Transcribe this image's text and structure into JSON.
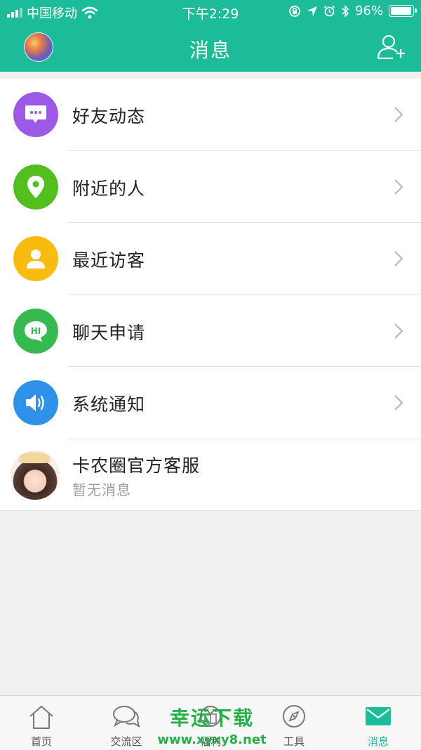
{
  "status_bar": {
    "carrier": "中国移动",
    "time": "下午2:29",
    "battery_text": "96%",
    "battery_level": 0.96,
    "icons": [
      "signal-bars-icon",
      "wifi-icon",
      "orientation-lock-icon",
      "location-arrow-icon",
      "alarm-icon",
      "bluetooth-icon",
      "battery-icon"
    ]
  },
  "header": {
    "title": "消息",
    "left_icon": "user-avatar",
    "right_icon": "add-friend-icon",
    "background_color": "#1dbc98"
  },
  "list": {
    "items": [
      {
        "label": "好友动态",
        "icon": "chat-bubble-icon",
        "color": "#9b59e6"
      },
      {
        "label": "附近的人",
        "icon": "location-pin-icon",
        "color": "#52bf1f"
      },
      {
        "label": "最近访客",
        "icon": "person-icon",
        "color": "#f9bb10"
      },
      {
        "label": "聊天申请",
        "icon": "hi-bubble-icon",
        "color": "#36b94f"
      },
      {
        "label": "系统通知",
        "icon": "speaker-icon",
        "color": "#2d91e9"
      }
    ],
    "service": {
      "title": "卡农圈官方客服",
      "subtitle": "暂无消息",
      "icon": "service-avatar"
    }
  },
  "tab_bar": {
    "tabs": [
      {
        "label": "首页",
        "icon": "home-icon",
        "active": false
      },
      {
        "label": "交流区",
        "icon": "chat-bubbles-icon",
        "active": false
      },
      {
        "label": "福利",
        "icon": "gift-icon",
        "active": false
      },
      {
        "label": "工具",
        "icon": "compass-icon",
        "active": false
      },
      {
        "label": "消息",
        "icon": "envelope-icon",
        "active": true
      }
    ],
    "active_color": "#1dbc98"
  },
  "watermark": {
    "line1": "幸运下载",
    "line2": "www.xyxy8.net"
  }
}
